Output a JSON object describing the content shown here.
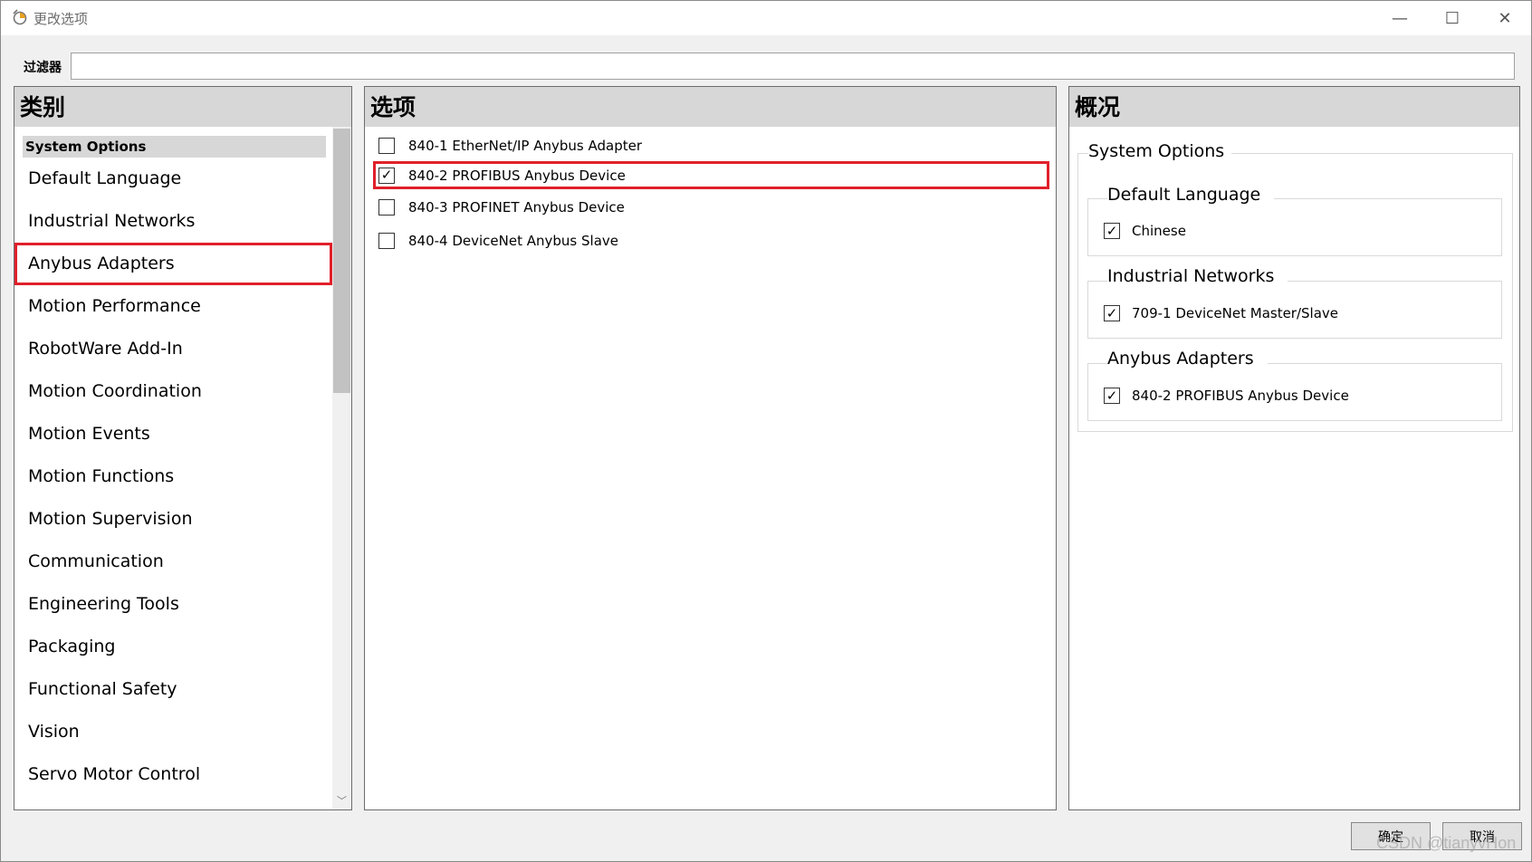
{
  "window": {
    "title": "更改选项",
    "minimize_glyph": "—",
    "maximize_glyph": "☐",
    "close_glyph": "✕"
  },
  "filter": {
    "label": "过滤器",
    "value": ""
  },
  "categories": {
    "header": "类别",
    "group": "System Options",
    "items": [
      "Default Language",
      "Industrial Networks",
      "Anybus Adapters",
      "Motion Performance",
      "RobotWare Add-In",
      "Motion Coordination",
      "Motion Events",
      "Motion Functions",
      "Motion Supervision",
      "Communication",
      "Engineering Tools",
      "Packaging",
      "Functional Safety",
      "Vision",
      "Servo Motor Control"
    ],
    "selected": "Anybus Adapters"
  },
  "options": {
    "header": "选项",
    "items": [
      {
        "label": "840-1 EtherNet/IP Anybus Adapter",
        "checked": false
      },
      {
        "label": "840-2 PROFIBUS Anybus Device",
        "checked": true
      },
      {
        "label": "840-3 PROFINET Anybus Device",
        "checked": false
      },
      {
        "label": "840-4 DeviceNet Anybus Slave",
        "checked": false
      }
    ]
  },
  "summary": {
    "header": "概况",
    "group": "System Options",
    "sections": [
      {
        "title": "Default Language",
        "item": "Chinese"
      },
      {
        "title": "Industrial Networks",
        "item": "709-1 DeviceNet Master/Slave"
      },
      {
        "title": "Anybus Adapters",
        "item": "840-2 PROFIBUS Anybus Device"
      }
    ]
  },
  "buttons": {
    "ok": "确定",
    "cancel": "取消"
  },
  "watermark": "CSDN @tianyvHon",
  "colors": {
    "highlight": "#e0202a",
    "header_bg": "#d7d7d7"
  }
}
